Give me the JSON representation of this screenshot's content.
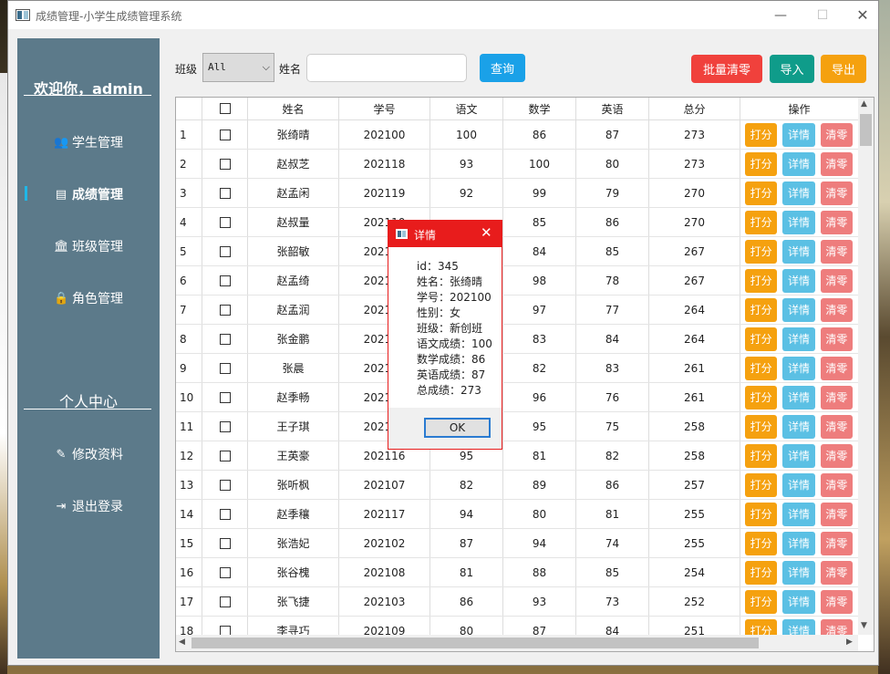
{
  "window": {
    "title": "成绩管理-小学生成绩管理系统",
    "minimize": "—",
    "maximize": "☐",
    "close": "✕"
  },
  "sidebar": {
    "welcome": "欢迎你，admin",
    "items": [
      {
        "label": "学生管理",
        "icon": "users-icon",
        "glyph": "👥"
      },
      {
        "label": "成绩管理",
        "icon": "card-icon",
        "glyph": "▤"
      },
      {
        "label": "班级管理",
        "icon": "bank-icon",
        "glyph": "🏛"
      },
      {
        "label": "角色管理",
        "icon": "lock-icon",
        "glyph": "🔒"
      }
    ],
    "section": "个人中心",
    "personal": [
      {
        "label": "修改资料",
        "icon": "edit-icon",
        "glyph": "✎"
      },
      {
        "label": "退出登录",
        "icon": "logout-icon",
        "glyph": "⇥"
      }
    ],
    "active_color": "#1fb7e8"
  },
  "toolbar": {
    "class_label": "班级",
    "class_value": "All",
    "name_label": "姓名",
    "name_value": "",
    "query": "查询",
    "batch_clear": "批量清零",
    "import": "导入",
    "export": "导出"
  },
  "table": {
    "headers": [
      "",
      "",
      "姓名",
      "学号",
      "语文",
      "数学",
      "英语",
      "总分",
      "操作"
    ],
    "actions": [
      "打分",
      "详情",
      "清零"
    ],
    "rows": [
      [
        "1",
        "张绮晴",
        "202100",
        "100",
        "86",
        "87",
        "273"
      ],
      [
        "2",
        "赵叔芝",
        "202118",
        "93",
        "100",
        "80",
        "273"
      ],
      [
        "3",
        "赵孟闲",
        "202119",
        "92",
        "99",
        "79",
        "270"
      ],
      [
        "4",
        "赵叔量",
        "202110",
        "",
        "85",
        "86",
        "270"
      ],
      [
        "5",
        "张韶敏",
        "202111",
        "",
        "84",
        "85",
        "267"
      ],
      [
        "6",
        "赵孟绮",
        "202120",
        "",
        "98",
        "78",
        "267"
      ],
      [
        "7",
        "赵孟润",
        "202113",
        "",
        "97",
        "77",
        "264"
      ],
      [
        "8",
        "张金鹏",
        "202114",
        "",
        "83",
        "84",
        "264"
      ],
      [
        "9",
        "张晨",
        "202115",
        "",
        "82",
        "83",
        "261"
      ],
      [
        "10",
        "赵季畅",
        "202112",
        "",
        "96",
        "76",
        "261"
      ],
      [
        "11",
        "王子琪",
        "202101",
        "",
        "95",
        "75",
        "258"
      ],
      [
        "12",
        "王英豪",
        "202116",
        "95",
        "81",
        "82",
        "258"
      ],
      [
        "13",
        "张听枫",
        "202107",
        "82",
        "89",
        "86",
        "257"
      ],
      [
        "14",
        "赵季穰",
        "202117",
        "94",
        "80",
        "81",
        "255"
      ],
      [
        "15",
        "张浩妃",
        "202102",
        "87",
        "94",
        "74",
        "255"
      ],
      [
        "16",
        "张谷槐",
        "202108",
        "81",
        "88",
        "85",
        "254"
      ],
      [
        "17",
        "张飞捷",
        "202103",
        "86",
        "93",
        "73",
        "252"
      ],
      [
        "18",
        "李寻巧",
        "202109",
        "80",
        "87",
        "84",
        "251"
      ]
    ]
  },
  "dialog": {
    "title": "详情",
    "close": "✕",
    "lines": [
      "id：345",
      "姓名：张绮晴",
      "学号：202100",
      "性别：女",
      "班级：新创班",
      "语文成绩：100",
      "数学成绩：86",
      "英语成绩：87",
      "总成绩：273"
    ],
    "ok": "OK"
  }
}
